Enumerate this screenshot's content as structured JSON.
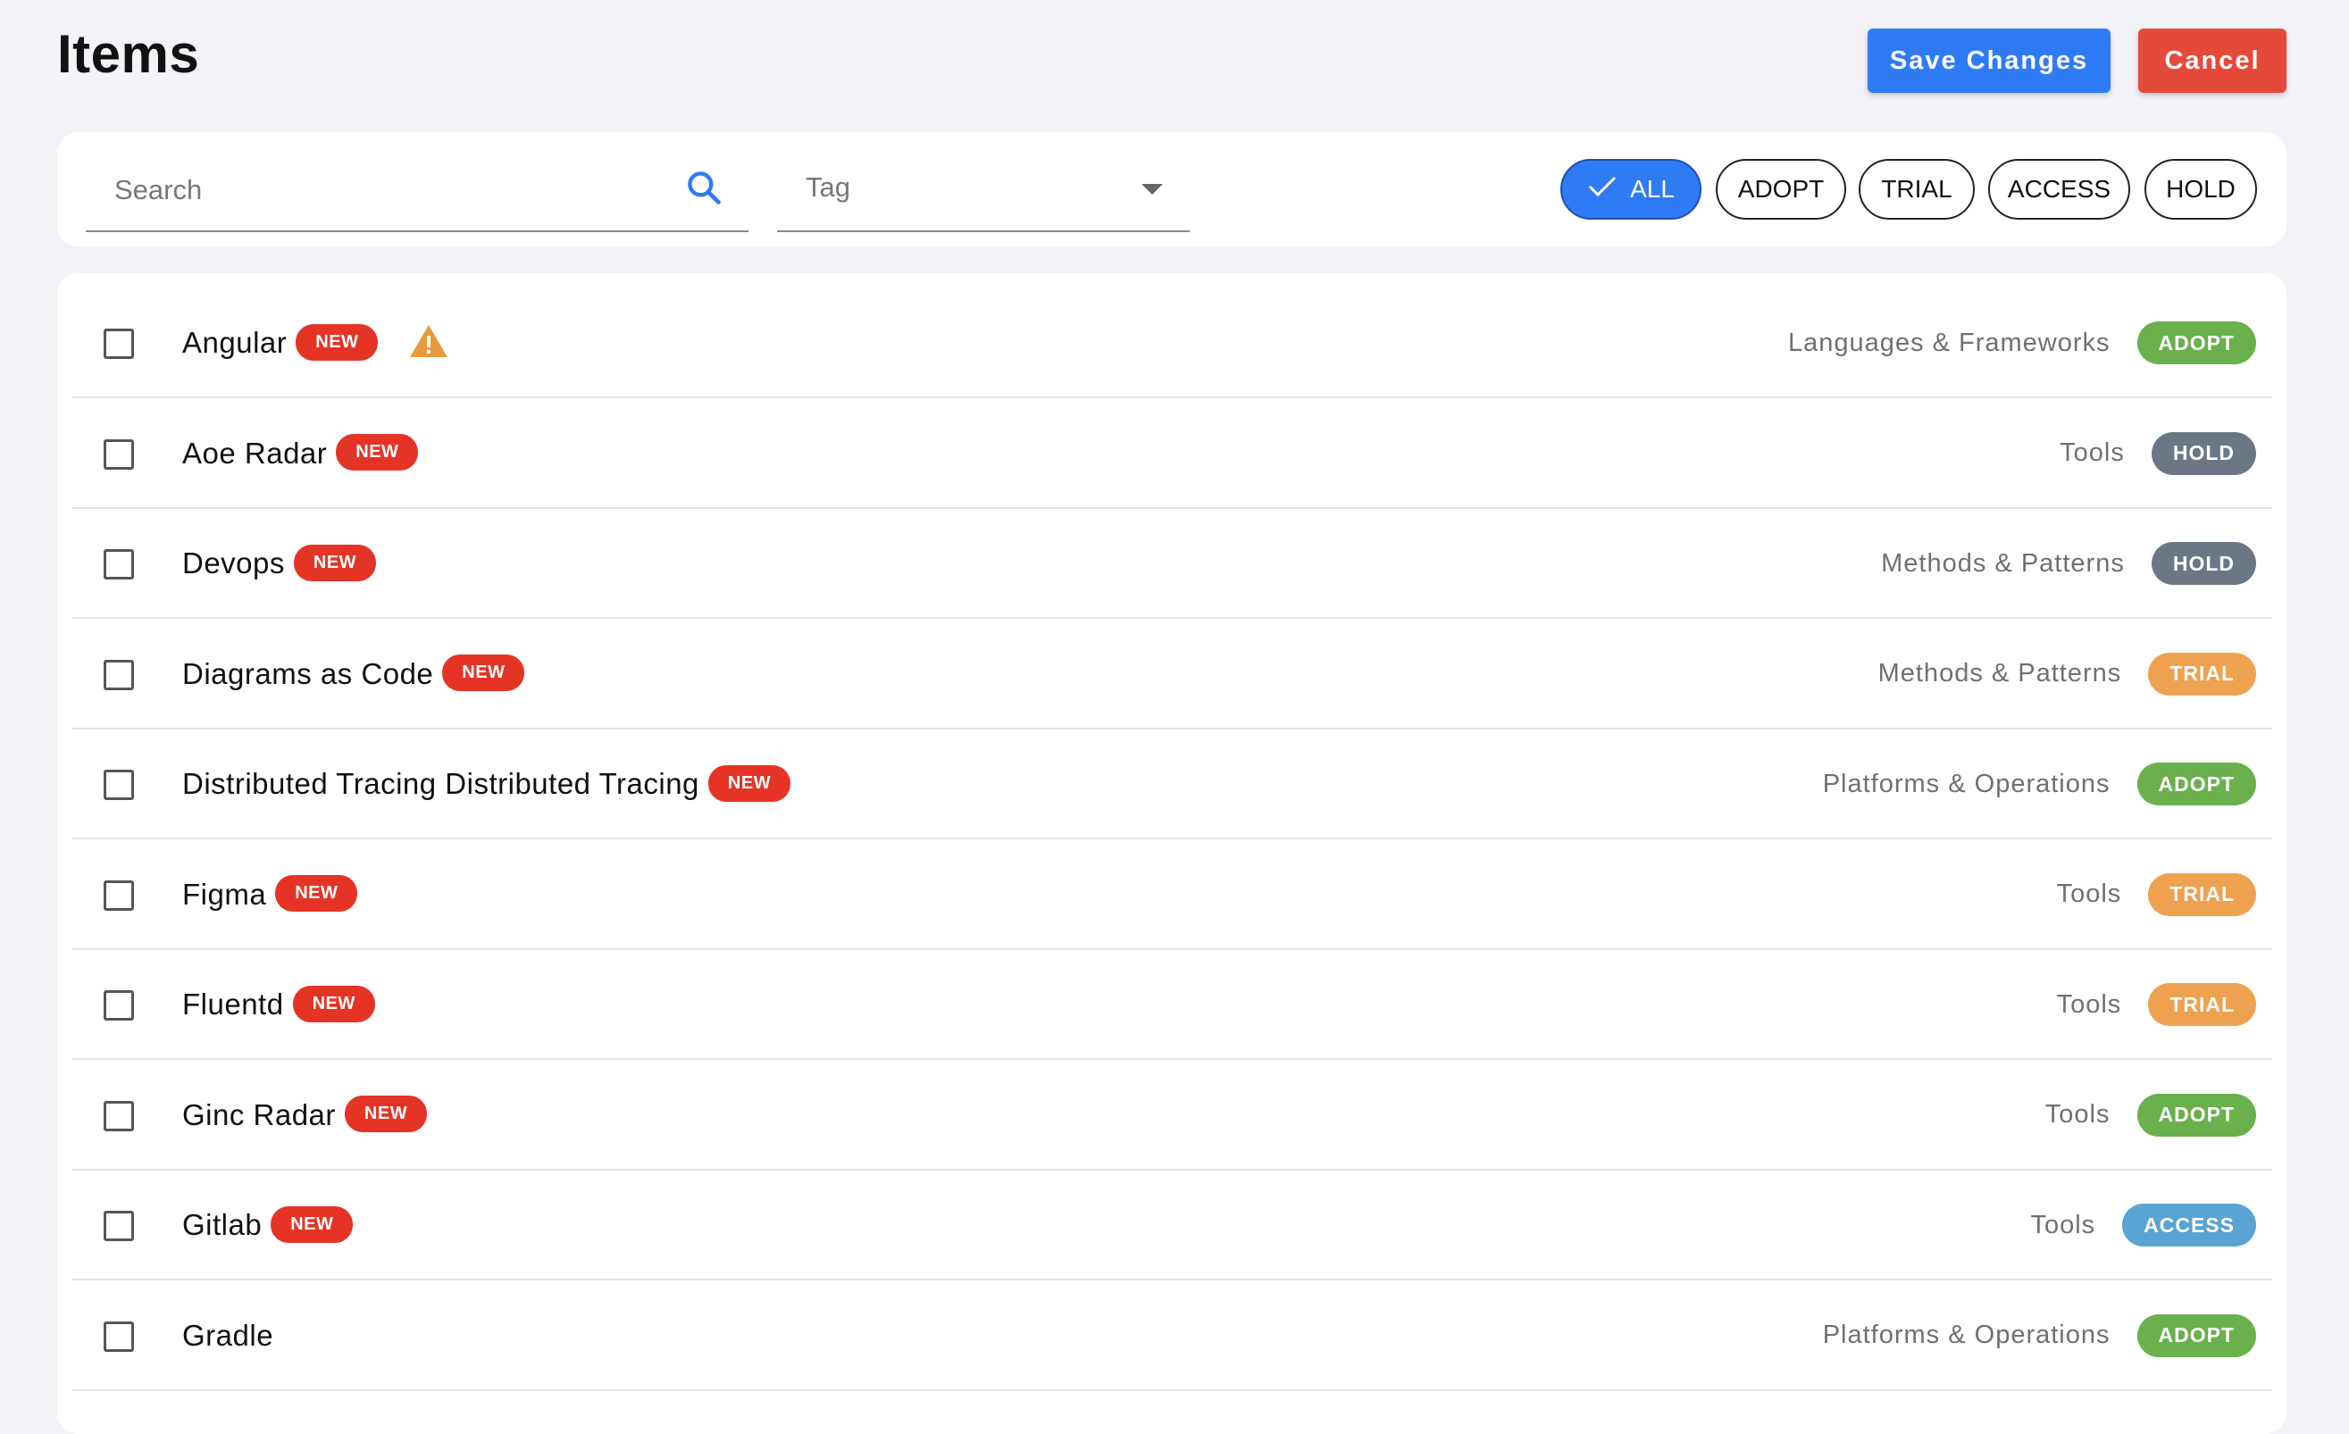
{
  "header": {
    "title": "Items",
    "save_label": "Save Changes",
    "cancel_label": "Cancel"
  },
  "filters": {
    "search_placeholder": "Search",
    "tag_label": "Tag",
    "chips": [
      {
        "label": "ALL",
        "selected": true
      },
      {
        "label": "ADOPT",
        "selected": false
      },
      {
        "label": "TRIAL",
        "selected": false
      },
      {
        "label": "ACCESS",
        "selected": false
      },
      {
        "label": "HOLD",
        "selected": false
      }
    ]
  },
  "new_label": "NEW",
  "items": [
    {
      "name": "Angular",
      "is_new": true,
      "warning": true,
      "category": "Languages & Frameworks",
      "status": "ADOPT"
    },
    {
      "name": "Aoe Radar",
      "is_new": true,
      "warning": false,
      "category": "Tools",
      "status": "HOLD"
    },
    {
      "name": "Devops",
      "is_new": true,
      "warning": false,
      "category": "Methods & Patterns",
      "status": "HOLD"
    },
    {
      "name": "Diagrams as Code",
      "is_new": true,
      "warning": false,
      "category": "Methods & Patterns",
      "status": "TRIAL"
    },
    {
      "name": "Distributed Tracing Distributed Tracing",
      "is_new": true,
      "warning": false,
      "category": "Platforms & Operations",
      "status": "ADOPT"
    },
    {
      "name": "Figma",
      "is_new": true,
      "warning": false,
      "category": "Tools",
      "status": "TRIAL"
    },
    {
      "name": "Fluentd",
      "is_new": true,
      "warning": false,
      "category": "Tools",
      "status": "TRIAL"
    },
    {
      "name": "Ginc Radar",
      "is_new": true,
      "warning": false,
      "category": "Tools",
      "status": "ADOPT"
    },
    {
      "name": "Gitlab",
      "is_new": true,
      "warning": false,
      "category": "Tools",
      "status": "ACCESS"
    },
    {
      "name": "Gradle",
      "is_new": false,
      "warning": false,
      "category": "Platforms & Operations",
      "status": "ADOPT"
    }
  ],
  "colors": {
    "primary": "#2f7bf5",
    "danger": "#e5493a",
    "new_badge": "#e53425",
    "adopt": "#6ab04c",
    "hold": "#6b7785",
    "trial": "#eea14f",
    "access": "#58a4d4",
    "warning": "#e89a3c"
  }
}
